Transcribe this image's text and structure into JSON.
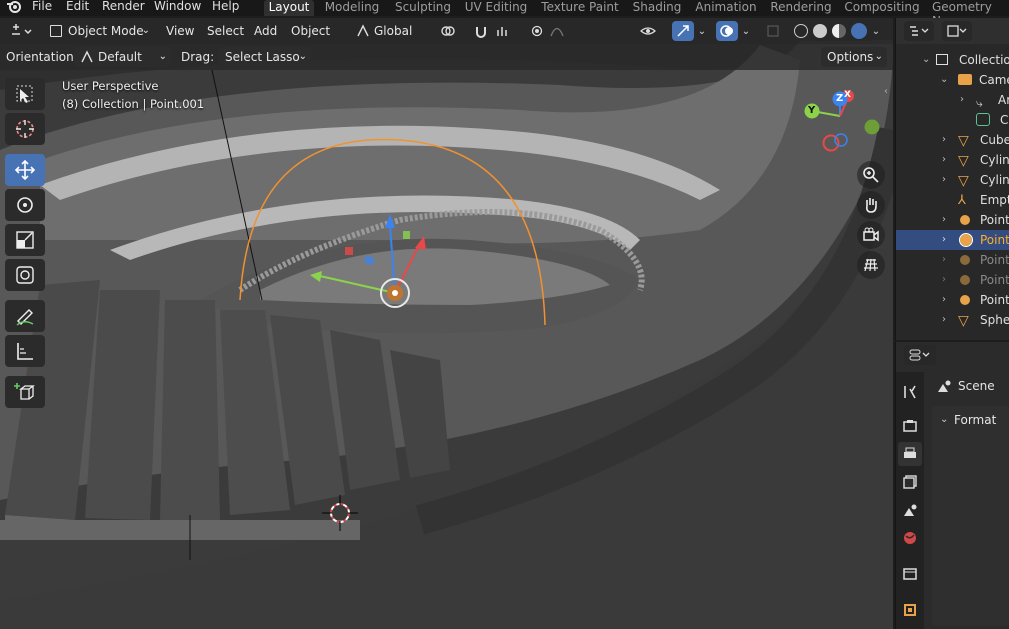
{
  "menu": {
    "items": [
      "File",
      "Edit",
      "Render",
      "Window",
      "Help"
    ]
  },
  "workspace_tabs": [
    "Layout",
    "Modeling",
    "Sculpting",
    "UV Editing",
    "Texture Paint",
    "Shading",
    "Animation",
    "Rendering",
    "Compositing",
    "Geometry Noc"
  ],
  "viewport_header": {
    "mode": "Object Mode",
    "menus": [
      "View",
      "Select",
      "Add",
      "Object"
    ],
    "transform_orientation": "Global"
  },
  "tool_settings": {
    "orientation_label": "Orientation:",
    "orientation_value": "Default",
    "drag_label": "Drag:",
    "drag_value": "Select Lasso",
    "options_label": "Options"
  },
  "viewport_overlay": {
    "perspective": "User Perspective",
    "context": "(8) Collection | Point.001"
  },
  "gizmo": {
    "x": "X",
    "y": "Y",
    "z": "Z"
  },
  "outliner": {
    "rows": [
      {
        "label": "Collection"
      },
      {
        "label": "Came"
      },
      {
        "label": "Ar"
      },
      {
        "label": "Ca"
      },
      {
        "label": "Cube"
      },
      {
        "label": "Cylinc"
      },
      {
        "label": "Cylinc"
      },
      {
        "label": "Empty"
      },
      {
        "label": "Point"
      },
      {
        "label": "Point."
      },
      {
        "label": "Point."
      },
      {
        "label": "Point."
      },
      {
        "label": "Point."
      },
      {
        "label": "Spher"
      }
    ]
  },
  "properties": {
    "context_title": "Scene",
    "panel_title": "Format"
  },
  "colors": {
    "accent_blue": "#4772b3",
    "selected_orange": "#ffaf29",
    "light_arc": "#f0922f"
  }
}
